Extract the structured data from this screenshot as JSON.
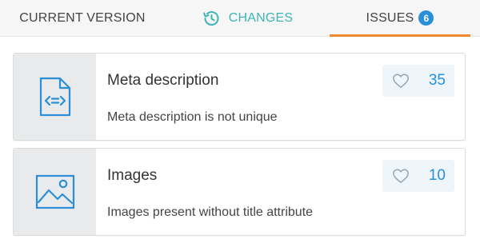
{
  "tabs": {
    "current_version": "CURRENT VERSION",
    "changes": "CHANGES",
    "issues": "ISSUES",
    "issues_count": "6"
  },
  "issues": [
    {
      "icon": "code-file-icon",
      "title": "Meta description",
      "description": "Meta description is not unique",
      "count": "35"
    },
    {
      "icon": "image-icon",
      "title": "Images",
      "description": "Images present without title attribute",
      "count": "10"
    }
  ],
  "colors": {
    "accent_teal": "#3fb6b4",
    "accent_orange": "#f08a2c",
    "accent_blue": "#2a8fd8"
  }
}
